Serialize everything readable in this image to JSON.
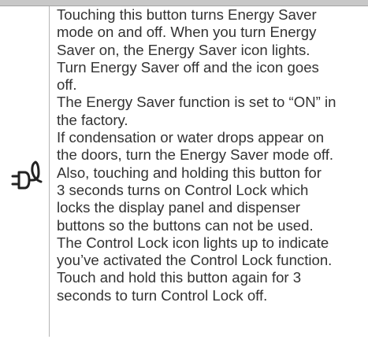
{
  "lines": [
    "Touching this button turns Energy Saver",
    "mode on and off. When you turn Energy",
    "Saver on, the Energy Saver icon lights.",
    "Turn Energy Saver off and the icon goes",
    "off.",
    "The Energy Saver function is set to “ON” in",
    "the factory.",
    "If condensation or water drops appear on",
    "the doors, turn the Energy Saver mode off.",
    "Also, touching and holding this button for",
    "3 seconds turns on Control Lock which",
    "locks the display panel and dispenser",
    "buttons so the buttons can not be used.",
    "The Control Lock icon lights up to indicate",
    "you’ve activated the Control Lock function.",
    "Touch and hold this button again for 3",
    "seconds to turn Control Lock off."
  ],
  "icon": "energy-saver-plug-icon"
}
